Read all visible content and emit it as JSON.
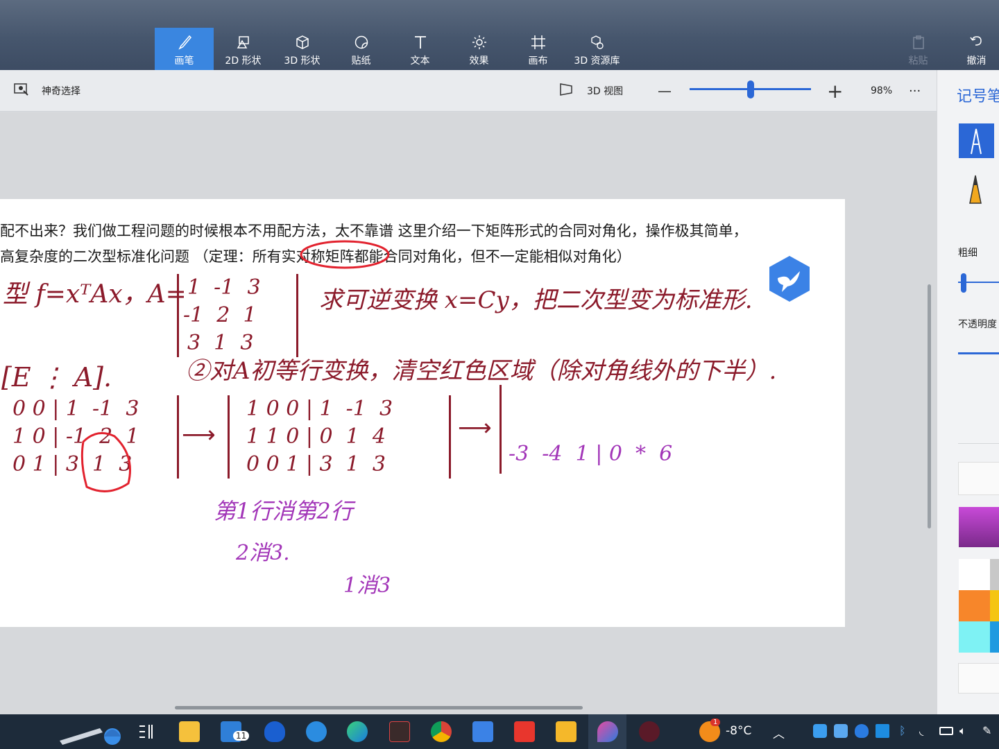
{
  "ribbon": {
    "tools": [
      {
        "label": "画笔",
        "icon": "brush-icon"
      },
      {
        "label": "2D 形状",
        "icon": "2d-shapes-icon"
      },
      {
        "label": "3D 形状",
        "icon": "3d-shapes-icon"
      },
      {
        "label": "贴纸",
        "icon": "stickers-icon"
      },
      {
        "label": "文本",
        "icon": "text-icon"
      },
      {
        "label": "效果",
        "icon": "effects-icon"
      },
      {
        "label": "画布",
        "icon": "canvas-icon"
      },
      {
        "label": "3D 资源库",
        "icon": "3d-library-icon"
      }
    ],
    "paste_label": "粘贴",
    "undo_label": "撤消",
    "accent": "#3a86e0"
  },
  "subbar": {
    "magic_select": "神奇选择",
    "view_3d": "3D 视图",
    "zoom": "98%",
    "zoom_level": 0.5,
    "minus": "—",
    "plus": "+",
    "more": "···"
  },
  "panel": {
    "title": "记号笔",
    "thickness": "粗细",
    "opacity": "不透明度"
  },
  "document": {
    "line1": "配不出来？我们做工程问题的时候根本不用配方法，太不靠谱 这里介绍一下矩阵形式的合同对角化，操作极其简单，",
    "line2": "高复杂度的二次型标准化问题 （定理：所有实对称矩阵都能合同对角化，但不一定能相似对角化）"
  },
  "handwriting": {
    "h1": "型 f=xᵀAx，A=",
    "h2": "求可逆变换 x=Cy，把二次型变为标准形.",
    "h3": "[E ⋮ A].",
    "h4": "②对A初等行变换，清空红色区域（除对角线外的下半）.",
    "h5": "第1行消第2行",
    "h6": "2消3.",
    "h7": "1消3",
    "matrix_A": [
      "1  -1  3",
      "-1  2  1",
      "3  1  3"
    ],
    "m1": [
      "0 0 | 1  -1  3",
      "1 0 | -1  2  1",
      "0 1 | 3  1  3"
    ],
    "m2": [
      "1 0 0 | 1  -1  3",
      "1 1 0 | 0  1  4",
      "0 0 1 | 3  1  3"
    ],
    "m3": "-3  -4  1 | 0  *  6",
    "colors": {
      "dark_red": "#8b1a2a",
      "red": "#e2222e",
      "purple": "#a235b8"
    }
  },
  "taskbar": {
    "weather_temp": "-8°C",
    "mail_badge": "11",
    "weather_badge": "1",
    "apps": [
      "widgets-icon",
      "file-explorer-icon",
      "mail-icon",
      "shield-app-icon",
      "ie-icon",
      "edge-icon",
      "halo-icon",
      "chrome-icon",
      "feishu-icon",
      "wps-icon",
      "notes-icon",
      "paint3d-icon",
      "app-icon"
    ]
  }
}
